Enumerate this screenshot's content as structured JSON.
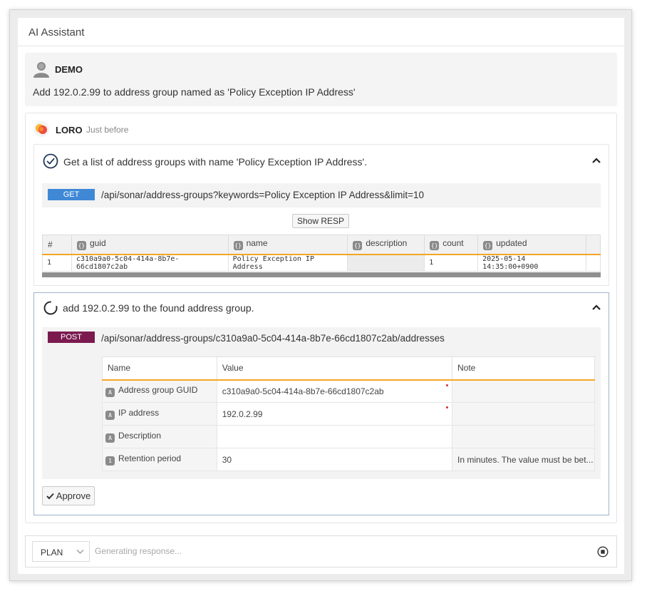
{
  "app": {
    "title": "AI Assistant"
  },
  "user_message": {
    "name": "DEMO",
    "text": "Add 192.0.2.99 to address group named as 'Policy Exception IP Address'"
  },
  "bot": {
    "name": "LORO",
    "time": "Just before"
  },
  "step1": {
    "title": "Get a list of address groups with name 'Policy Exception IP Address'.",
    "method": "GET",
    "url": "/api/sonar/address-groups?keywords=Policy Exception IP Address&limit=10",
    "show_resp_label": "Show RESP",
    "table": {
      "columns": [
        "#",
        "guid",
        "name",
        "description",
        "count",
        "updated"
      ],
      "column_type_tag": "{}",
      "rows": [
        [
          "1",
          "c310a9a0-5c04-414a-8b7e-66cd1807c2ab",
          "Policy Exception IP Address",
          "",
          "1",
          "2025-05-14 14:35:00+0900"
        ]
      ]
    }
  },
  "step2": {
    "title": "add 192.0.2.99 to the found address group.",
    "method": "POST",
    "url": "/api/sonar/address-groups/c310a9a0-5c04-414a-8b7e-66cd1807c2ab/addresses",
    "columns": [
      "Name",
      "Value",
      "Note"
    ],
    "params": [
      {
        "type": "A",
        "name": "Address group GUID",
        "value": "c310a9a0-5c04-414a-8b7e-66cd1807c2ab",
        "note": "",
        "required": true
      },
      {
        "type": "A",
        "name": "IP address",
        "value": "192.0.2.99",
        "note": "",
        "required": true
      },
      {
        "type": "A",
        "name": "Description",
        "value": "",
        "note": "",
        "required": false
      },
      {
        "type": "1",
        "name": "Retention period",
        "value": "30",
        "note": "In minutes. The value must be bet...",
        "required": false
      }
    ],
    "approve_label": "Approve"
  },
  "composer": {
    "mode": "PLAN",
    "placeholder": "Generating response..."
  },
  "colors": {
    "get": "#3f88d6",
    "post": "#7b1a4f",
    "header_underline": "#f5a623"
  },
  "icons": {
    "avatar": "user-avatar-icon",
    "bot": "loro-logo-icon",
    "done": "check-circle-icon",
    "progress": "spinner-icon",
    "collapse": "chevron-up-icon",
    "approve": "check-icon",
    "mode": "chevron-down-icon",
    "stop": "stop-circle-icon"
  }
}
